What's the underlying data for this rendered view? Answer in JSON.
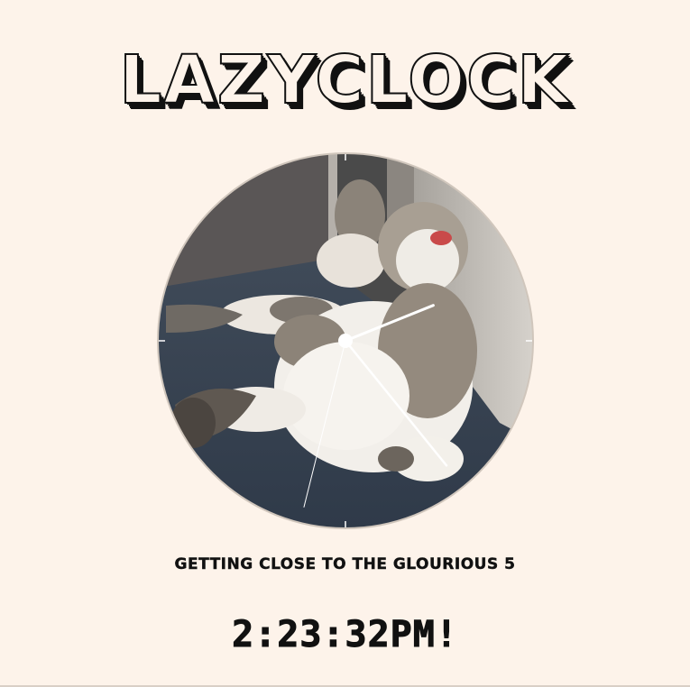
{
  "app": {
    "title": "LAZYCLOCK"
  },
  "clock": {
    "image_description_icon": "sleeping-cat-photo",
    "hands": {
      "hour_angle_deg": 68,
      "minute_angle_deg": 141,
      "second_angle_deg": 194
    }
  },
  "caption": {
    "text": "GETTING CLOSE TO THE GLOURIOUS 5"
  },
  "time": {
    "text": "2:23:32PM!"
  },
  "colors": {
    "background": "#fdf3ea",
    "text": "#111111",
    "hand": "#ffffff"
  }
}
